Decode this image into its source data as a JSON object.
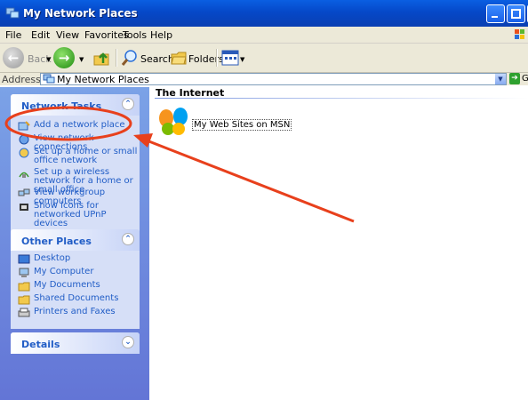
{
  "window": {
    "title": "My Network Places",
    "app_icon": "network-places-icon"
  },
  "menu": {
    "items": [
      "File",
      "Edit",
      "View",
      "Favorites",
      "Tools",
      "Help"
    ]
  },
  "toolbar": {
    "back_label": "Back",
    "search_label": "Search",
    "folders_label": "Folders"
  },
  "address": {
    "label": "Address",
    "value": "My Network Places",
    "go_label": "Go"
  },
  "network_tasks": {
    "title": "Network Tasks",
    "items": [
      {
        "label": "Add a network place",
        "icon": "add-network-place-icon"
      },
      {
        "label": "View network connections",
        "icon": "network-connections-icon"
      },
      {
        "label": "Set up a home or small office network",
        "icon": "home-network-icon"
      },
      {
        "label": "Set up a wireless network for a home or small office",
        "icon": "wireless-network-icon"
      },
      {
        "label": "View workgroup computers",
        "icon": "workgroup-icon"
      },
      {
        "label": "Show icons for networked UPnP devices",
        "icon": "upnp-icon"
      }
    ]
  },
  "other_places": {
    "title": "Other Places",
    "items": [
      {
        "label": "Desktop",
        "icon": "desktop-icon"
      },
      {
        "label": "My Computer",
        "icon": "my-computer-icon"
      },
      {
        "label": "My Documents",
        "icon": "my-documents-icon"
      },
      {
        "label": "Shared Documents",
        "icon": "shared-documents-icon"
      },
      {
        "label": "Printers and Faxes",
        "icon": "printers-icon"
      }
    ]
  },
  "details": {
    "title": "Details"
  },
  "content": {
    "group_title": "The Internet",
    "items": [
      {
        "label": "My Web Sites on MSN",
        "icon": "msn-butterfly-icon"
      }
    ]
  },
  "annotation": {
    "color": "#e8401c"
  }
}
